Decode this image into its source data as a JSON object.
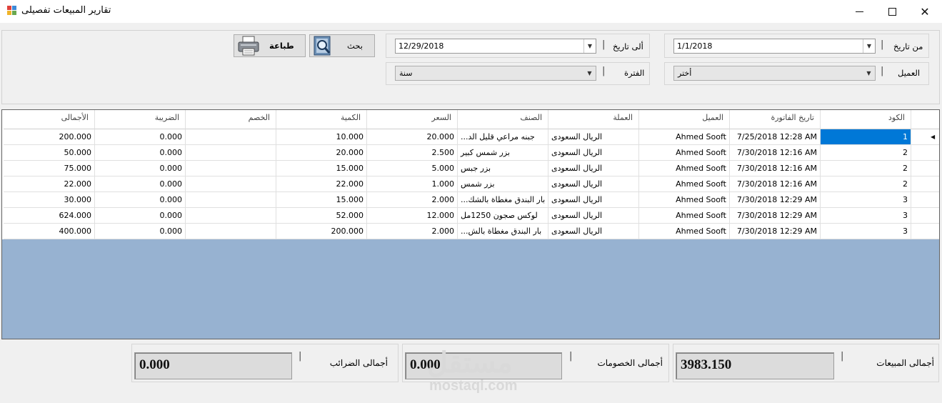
{
  "window": {
    "title": "تقارير المبيعات تفصيلى"
  },
  "filters": {
    "from_date_label": "من تاريخ",
    "from_date_value": "1/1/2018",
    "customer_label": "العميل",
    "customer_value": "أختر",
    "to_date_label": "ألى تاريخ",
    "to_date_value": "12/29/2018",
    "period_label": "الفترة",
    "period_value": "سنة",
    "search_label": "بحث",
    "print_label": "طباعة"
  },
  "grid": {
    "columns": [
      "الكود",
      "تاريخ الفاتورة",
      "العميل",
      "العملة",
      "الصنف",
      "السعر",
      "الكمية",
      "الخصم",
      "الضريبة",
      "الأجمالى"
    ],
    "rows": [
      [
        "1",
        "7/25/2018 12:28 AM",
        "Ahmed Sooft",
        "الريال السعودى",
        "جبنه مراعي قليل الد...",
        "20.000",
        "10.000",
        "",
        "0.000",
        "200.000"
      ],
      [
        "2",
        "7/30/2018 12:16 AM",
        "Ahmed Sooft",
        "الريال السعودى",
        "بزر شمس كبير",
        "2.500",
        "20.000",
        "",
        "0.000",
        "50.000"
      ],
      [
        "2",
        "7/30/2018 12:16 AM",
        "Ahmed Sooft",
        "الريال السعودى",
        "بزر جبس",
        "5.000",
        "15.000",
        "",
        "0.000",
        "75.000"
      ],
      [
        "2",
        "7/30/2018 12:16 AM",
        "Ahmed Sooft",
        "الريال السعودى",
        "بزر شمس",
        "1.000",
        "22.000",
        "",
        "0.000",
        "22.000"
      ],
      [
        "3",
        "7/30/2018 12:29 AM",
        "Ahmed Sooft",
        "الريال السعودى",
        "بار البندق مغطاة بالشك...",
        "2.000",
        "15.000",
        "",
        "0.000",
        "30.000"
      ],
      [
        "3",
        "7/30/2018 12:29 AM",
        "Ahmed Sooft",
        "الريال السعودى",
        "لوكس صجون 1250مل",
        "12.000",
        "52.000",
        "",
        "0.000",
        "624.000"
      ],
      [
        "3",
        "7/30/2018 12:29 AM",
        "Ahmed Sooft",
        "الريال السعودى",
        "بار البندق مغطاة بالش...",
        "2.000",
        "200.000",
        "",
        "0.000",
        "400.000"
      ]
    ]
  },
  "totals": {
    "sales_label": "أجمالى المبيعات",
    "sales_value": "3983.150",
    "discounts_label": "أجمالى الخصومات",
    "discounts_value": "0.000",
    "taxes_label": "أجمالى الضرائب",
    "taxes_value": "0.000"
  },
  "watermark": {
    "arabic": "مستقل",
    "latin": "mostaql.com"
  }
}
